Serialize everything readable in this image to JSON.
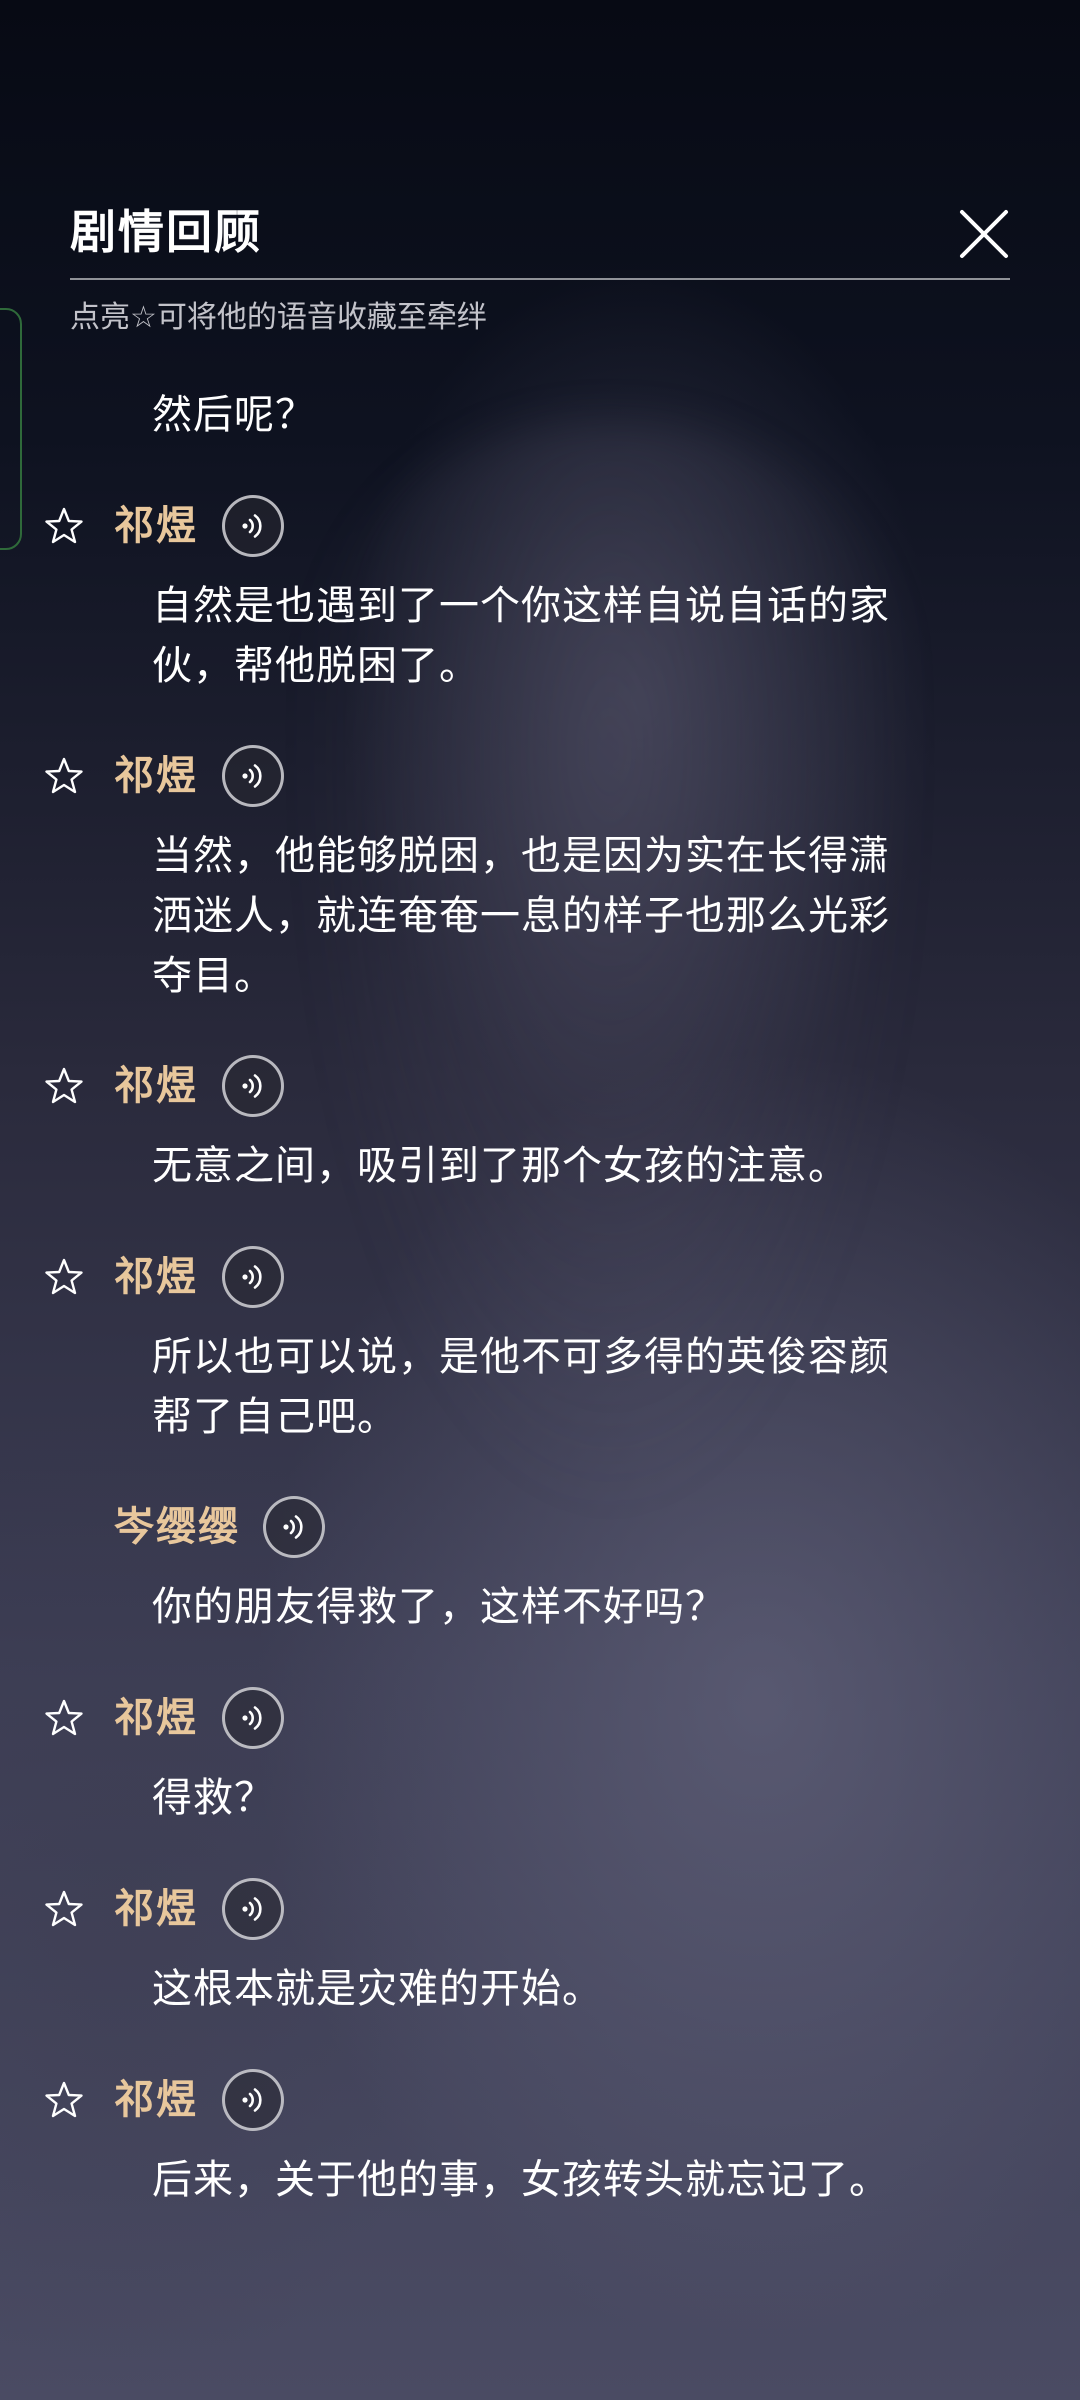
{
  "header": {
    "title": "剧情回顾",
    "hint": "点亮☆可将他的语音收藏至牵绊"
  },
  "icons": {
    "close": "close-icon",
    "star": "star-outline-icon",
    "voice": "voice-play-icon"
  },
  "colors": {
    "speaker_name": "#e8c79c",
    "text": "#ffffff"
  },
  "dialogue": [
    {
      "speaker": "",
      "text": "然后呢？"
    },
    {
      "speaker": "祁煜",
      "text": "自然是也遇到了一个你这样自说自话的家伙，帮他脱困了。"
    },
    {
      "speaker": "祁煜",
      "text": "当然，他能够脱困，也是因为实在长得潇洒迷人，就连奄奄一息的样子也那么光彩夺目。"
    },
    {
      "speaker": "祁煜",
      "text": "无意之间，吸引到了那个女孩的注意。"
    },
    {
      "speaker": "祁煜",
      "text": "所以也可以说，是他不可多得的英俊容颜帮了自己吧。"
    },
    {
      "speaker": "岑缨缨",
      "text": "你的朋友得救了，这样不好吗？"
    },
    {
      "speaker": "祁煜",
      "text": "得救？"
    },
    {
      "speaker": "祁煜",
      "text": "这根本就是灾难的开始。"
    },
    {
      "speaker": "祁煜",
      "text": "后来，关于他的事，女孩转头就忘记了。"
    }
  ],
  "lines": {
    "e0": [
      "然后呢？"
    ],
    "e1": [
      "自然是也遇到了一个你这样自说自话的家",
      "伙，帮他脱困了。"
    ],
    "e2": [
      "当然，他能够脱困，也是因为实在长得潇",
      "洒迷人，就连奄奄一息的样子也那么光彩",
      "夺目。"
    ],
    "e3": [
      "无意之间，吸引到了那个女孩的注意。"
    ],
    "e4": [
      "所以也可以说，是他不可多得的英俊容颜",
      "帮了自己吧。"
    ],
    "e5": [
      "你的朋友得救了，这样不好吗？"
    ],
    "e6": [
      "得救？"
    ],
    "e7": [
      "这根本就是灾难的开始。"
    ],
    "e8": [
      "后来，关于他的事，女孩转头就忘记了。"
    ]
  }
}
